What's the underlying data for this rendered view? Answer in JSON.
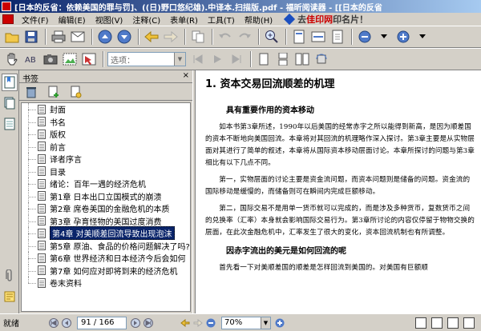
{
  "window": {
    "title": "[日本的反省：依赖美国的罪与罚]、((日)野口悠纪雄).中译本.扫描版.pdf - 福昕阅读器 - [[日本的反省"
  },
  "menubar": {
    "items": [
      "文件(F)",
      "编辑(E)",
      "视图(V)",
      "注释(C)",
      "表单(R)",
      "工具(T)",
      "帮助(H)"
    ],
    "promo_prefix": "去",
    "promo_brand": "佳印网",
    "promo_suffix": "印名片！"
  },
  "toolbar2": {
    "zoom_placeholder": "选项："
  },
  "bookmarks": {
    "title": "书签",
    "close": "×",
    "items": [
      {
        "label": "封面"
      },
      {
        "label": "书名"
      },
      {
        "label": "版权"
      },
      {
        "label": "前言"
      },
      {
        "label": "译者序言"
      },
      {
        "label": "目录"
      },
      {
        "label": "绪论：百年一遇的经济危机"
      },
      {
        "label": "第1章 日本出口立国模式的崩溃"
      },
      {
        "label": "第2章 席卷美国的金融危机的本质"
      },
      {
        "label": "第3章 孕育怪物的美国过度消费"
      },
      {
        "label": "第4章 对美顺差回流导致出现泡沫"
      },
      {
        "label": "第5章 原油、食品的价格问题解决了吗?"
      },
      {
        "label": "第6章 世界经济和日本经济今后会如何"
      },
      {
        "label": "第7章 如何应对即将到来的经济危机"
      },
      {
        "label": "卷末资料"
      }
    ],
    "selected_index": 10
  },
  "document": {
    "heading": "1. 资本交易回流顺差的机理",
    "subheading1": "具有重要作用的资本移动",
    "p1": "如本书第3章所述，1990年以后美国的经常赤字之所以能得到新高，是因为顺差国的资本不断地向美国回流。本章将对其回流的机理略作深入探讨。第3章主要是从实物层面对其进行了简单的叙述，本章将从国际资本移动层面讨论。本章所探讨的问题与第3章相比有以下几点不同。",
    "p2": "第一，实物层面的讨论主要是资金流问题，而资本问题则是储备的问题。资金流的国际移动是缓慢的，而储备则可在瞬间内完成巨额移动。",
    "p3": "第二，国际交易不是用单一货币就可以完成的，而是涉及多种货币，复数货币之间的兑换率（汇率）本身就会影响国际交易行为。第3章所讨论的内容仅停留于物物交换的层面，在此次金融危机中，汇率发生了很大的变化，资本回流机制也有所调整。",
    "subheading2": "因赤字流出的美元是如何回流的呢",
    "p4": "首先看一下对美顺差国的顺差是怎样回流到美国的。对美国有巨额顺"
  },
  "status": {
    "ready": "就绪",
    "page": "91 / 166",
    "zoom": "70%"
  }
}
